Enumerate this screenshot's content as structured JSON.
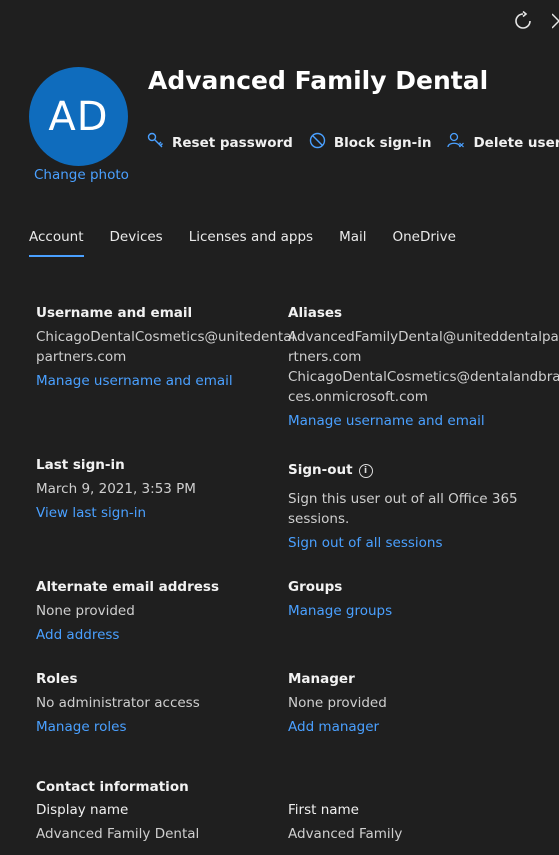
{
  "header": {
    "avatar_initials": "AD",
    "change_photo": "Change photo",
    "user_name": "Advanced Family Dental",
    "actions": {
      "reset_password": "Reset password",
      "block_signin": "Block sign-in",
      "delete_user": "Delete user"
    }
  },
  "tabs": [
    {
      "label": "Account",
      "active": true
    },
    {
      "label": "Devices",
      "active": false
    },
    {
      "label": "Licenses and apps",
      "active": false
    },
    {
      "label": "Mail",
      "active": false
    },
    {
      "label": "OneDrive",
      "active": false
    }
  ],
  "sections": {
    "username": {
      "label": "Username and email",
      "value_line1": "ChicagoDentalCosmetics@unitedental",
      "value_line2": "partners.com",
      "link": "Manage username and email"
    },
    "aliases": {
      "label": "Aliases",
      "lines": [
        "AdvancedFamilyDental@uniteddentalpa",
        "rtners.com",
        "ChicagoDentalCosmetics@dentalandbra",
        "ces.onmicrosoft.com"
      ],
      "link": "Manage username and email"
    },
    "last_signin": {
      "label": "Last sign-in",
      "value": "March 9, 2021, 3:53 PM",
      "link": "View last sign-in"
    },
    "signout": {
      "label": "Sign-out",
      "value_line1": "Sign this user out of all Office 365",
      "value_line2": "sessions.",
      "link": "Sign out of all sessions"
    },
    "alt_email": {
      "label": "Alternate email address",
      "value": "None provided",
      "link": "Add address"
    },
    "groups": {
      "label": "Groups",
      "link": "Manage groups"
    },
    "roles": {
      "label": "Roles",
      "value": "No administrator access",
      "link": "Manage roles"
    },
    "manager": {
      "label": "Manager",
      "value": "None provided",
      "link": "Add manager"
    },
    "contact": {
      "label": "Contact information",
      "display_name_label": "Display name",
      "display_name_value": "Advanced Family Dental",
      "first_name_label": "First name",
      "first_name_value": "Advanced Family"
    }
  },
  "colors": {
    "background": "#1f1f1f",
    "accent": "#4aa0ff",
    "avatar": "#0f6cbd"
  }
}
